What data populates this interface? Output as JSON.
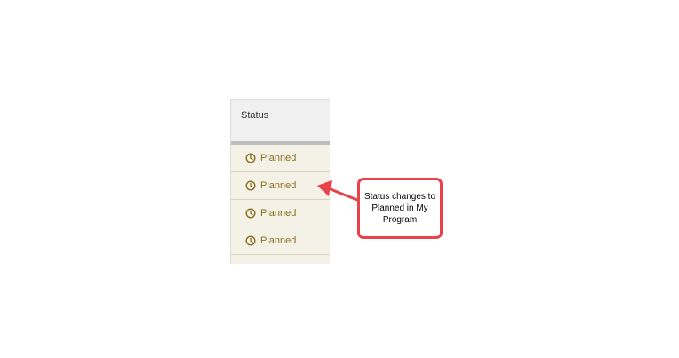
{
  "table": {
    "header": "Status",
    "rows": [
      {
        "label": "Planned",
        "icon": "clock-icon"
      },
      {
        "label": "Planned",
        "icon": "clock-icon"
      },
      {
        "label": "Planned",
        "icon": "clock-icon"
      },
      {
        "label": "Planned",
        "icon": "clock-icon"
      }
    ],
    "status_color": "#8a6e1f"
  },
  "callout": {
    "text": "Status changes to Planned in My Program",
    "border_color": "#e8434a"
  }
}
